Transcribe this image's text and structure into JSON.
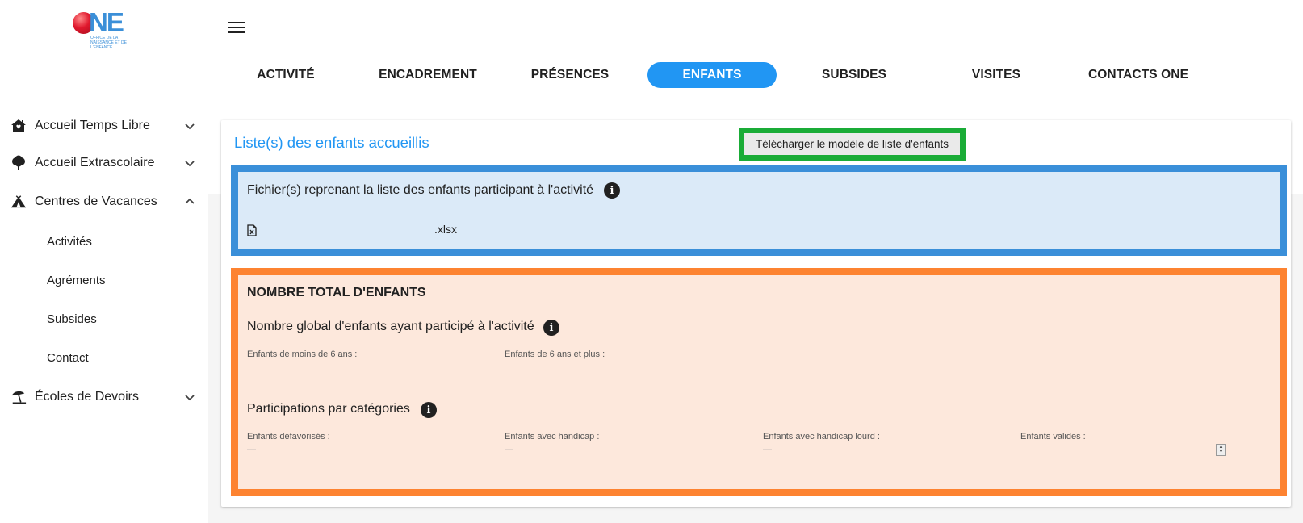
{
  "logo": {
    "word": "NE",
    "subtitle": "Office de la naissance et de l'enfance"
  },
  "sidebar": {
    "items": [
      {
        "label": "Accueil Temps Libre"
      },
      {
        "label": "Accueil Extrascolaire"
      },
      {
        "label": "Centres de Vacances"
      },
      {
        "label": "Écoles de Devoirs"
      }
    ],
    "subitems": [
      {
        "label": "Activités"
      },
      {
        "label": "Agréments"
      },
      {
        "label": "Subsides"
      },
      {
        "label": "Contact"
      }
    ]
  },
  "tabs": [
    {
      "label": "ACTIVITÉ"
    },
    {
      "label": "ENCADREMENT"
    },
    {
      "label": "PRÉSENCES"
    },
    {
      "label": "ENFANTS",
      "active": true
    },
    {
      "label": "SUBSIDES"
    },
    {
      "label": "VISITES"
    },
    {
      "label": "CONTACTS ONE"
    }
  ],
  "card": {
    "title": "Liste(s) des enfants accueillis",
    "download_label": "Télécharger le modèle de liste d'enfants",
    "files_section": {
      "label": "Fichier(s) reprenant la liste des enfants participant à l'activité",
      "file_name": ".xlsx"
    },
    "totals": {
      "heading": "NOMBRE TOTAL D'ENFANTS",
      "global_label": "Nombre global d'enfants ayant participé à l'activité",
      "under6_label": "Enfants de moins de 6 ans :",
      "over6_label": "Enfants de 6 ans et plus :",
      "categories_label": "Participations par catégories",
      "categories": [
        {
          "label": "Enfants défavorisés :",
          "value": "—"
        },
        {
          "label": "Enfants avec handicap :",
          "value": "—"
        },
        {
          "label": "Enfants avec handicap lourd :",
          "value": "—"
        },
        {
          "label": "Enfants valides :",
          "value": ""
        }
      ]
    }
  },
  "colors": {
    "accent": "#2196f3",
    "files_border": "#3a8fd9",
    "files_bg": "#dbeaf8",
    "totals_border": "#fd8331",
    "totals_bg": "#fde8dc",
    "download_border": "#1aac37"
  },
  "info_glyph": "i"
}
